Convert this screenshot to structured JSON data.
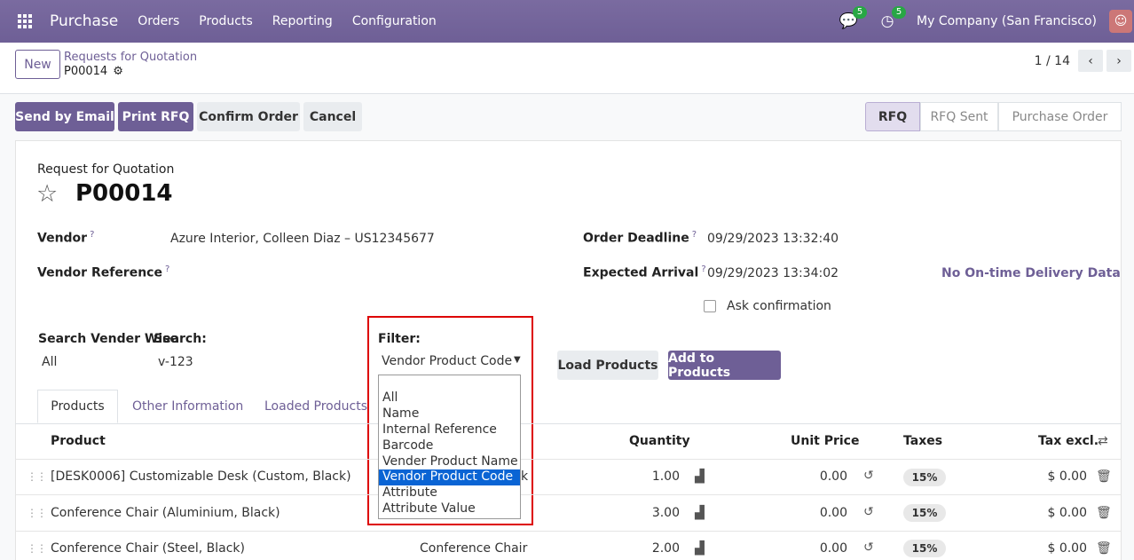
{
  "navbar": {
    "app_name": "Purchase",
    "menus": [
      "Orders",
      "Products",
      "Reporting",
      "Configuration"
    ],
    "messages_count": "5",
    "activities_count": "5",
    "company": "My Company (San Francisco)"
  },
  "control": {
    "new_label": "New",
    "breadcrumb": "Requests for Quotation",
    "record": "P00014",
    "pager": "1 / 14"
  },
  "actions": {
    "send_email": "Send by Email",
    "print_rfq": "Print RFQ",
    "confirm": "Confirm Order",
    "cancel": "Cancel"
  },
  "status": {
    "stages": [
      "RFQ",
      "RFQ Sent",
      "Purchase Order"
    ],
    "active": "RFQ"
  },
  "form": {
    "doc_label": "Request for Quotation",
    "title": "P00014",
    "vendor_label": "Vendor",
    "vendor_value": "Azure Interior, Colleen Diaz – US12345677",
    "vendor_ref_label": "Vendor Reference",
    "order_deadline_label": "Order Deadline",
    "order_deadline_value": "09/29/2023 13:32:40",
    "expected_arrival_label": "Expected Arrival",
    "expected_arrival_value": "09/29/2023 13:34:02",
    "ontime_link": "No On-time Delivery Data",
    "ask_confirmation": "Ask confirmation",
    "help_mark": "?",
    "search_vendor_label": "Search Vender Wise",
    "search_vendor_value": "All",
    "search_label": "Search:",
    "search_value": "v-123",
    "filter_label": "Filter:",
    "filter_selected": "Vendor Product Code",
    "filter_options": [
      "All",
      "Name",
      "Internal Reference",
      "Barcode",
      "Vender Product Name",
      "Vendor Product Code",
      "Attribute",
      "Attribute Value"
    ],
    "load_products": "Load Products",
    "add_to_products": "Add to Products"
  },
  "tabs": [
    "Products",
    "Other Information",
    "Loaded Products List"
  ],
  "table": {
    "headers": {
      "product": "Product",
      "quantity": "Quantity",
      "unit_price": "Unit Price",
      "taxes": "Taxes",
      "tax_excl": "Tax excl."
    },
    "rows": [
      {
        "product": "[DESK0006] Customizable Desk (Custom, Black)",
        "description": "k",
        "qty": "1.00",
        "price": "0.00",
        "tax": "15%",
        "subtotal": "$ 0.00"
      },
      {
        "product": "Conference Chair (Aluminium, Black)",
        "description": "",
        "qty": "3.00",
        "price": "0.00",
        "tax": "15%",
        "subtotal": "$ 0.00"
      },
      {
        "product": "Conference Chair (Steel, Black)",
        "description": "Conference Chair",
        "qty": "2.00",
        "price": "0.00",
        "tax": "15%",
        "subtotal": "$ 0.00"
      }
    ]
  }
}
